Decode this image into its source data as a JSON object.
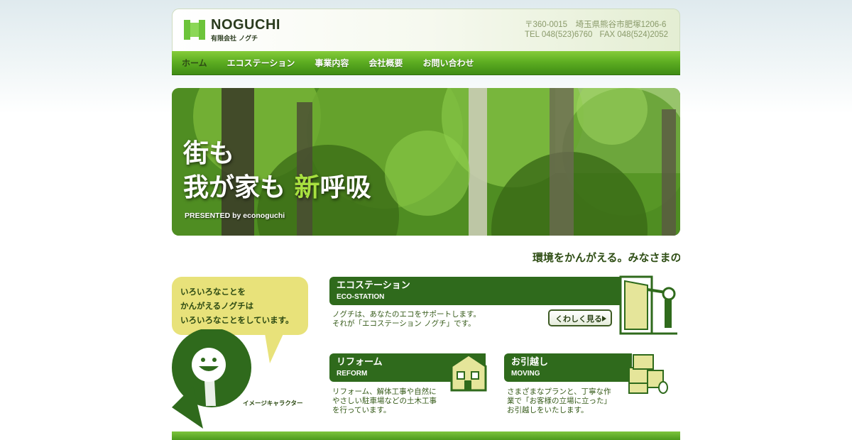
{
  "header": {
    "brand": "NOGUCHI",
    "brand_sub": "有限会社 ノグチ",
    "address": "〒360-0015　埼玉県熊谷市肥塚1206-6",
    "tel": "TEL 048(523)6760",
    "fax": "FAX 048(524)2052"
  },
  "nav": {
    "items": [
      {
        "label": "ホーム"
      },
      {
        "label": "エコステーション"
      },
      {
        "label": "事業内容"
      },
      {
        "label": "会社概要"
      },
      {
        "label": "お問い合わせ"
      }
    ]
  },
  "hero": {
    "line1": "街も",
    "line2_a": "我が家も ",
    "line2_highlight": "新",
    "line2_b": "呼吸",
    "presented": "PRESENTED by econoguchi"
  },
  "marquee": {
    "text": "環境をかんがえる。みなさまの"
  },
  "character": {
    "bubble_line1": "いろいろなことを",
    "bubble_line2": "かんがえるノグチは",
    "bubble_line3": "いろいろなことをしています。",
    "label": "イメージキャラクター"
  },
  "services": {
    "eco": {
      "title": "エコステーション",
      "sub": "ECO-STATION",
      "desc1": "ノグチは、あなたのエコをサポートします。",
      "desc2": "それが「エコステーション ノグチ」です。",
      "more": "くわしく見る"
    },
    "reform": {
      "title": "リフォーム",
      "sub": "REFORM",
      "desc1": "リフォーム、解体工事や自然に",
      "desc2": "やさしい駐車場などの土木工事",
      "desc3": "を行っています。"
    },
    "moving": {
      "title": "お引越し",
      "sub": "MOVING",
      "desc1": "さまざまなプランと、丁寧な作",
      "desc2": "業で「お客様の立場に立った」",
      "desc3": "お引越しをいたします。"
    }
  },
  "colors": {
    "brand_green": "#5eae22",
    "dark_green": "#2f6a1c",
    "highlight": "#a8e040",
    "bubble": "#e8e27a"
  }
}
